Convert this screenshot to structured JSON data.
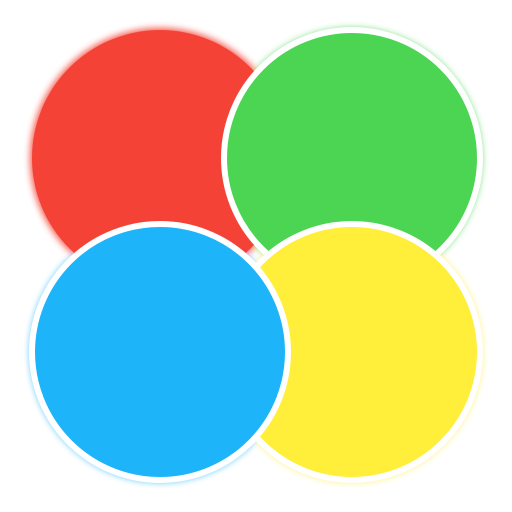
{
  "icon": {
    "name": "four-circle-logo",
    "colors": {
      "red": "#F44336",
      "green": "#4CD453",
      "blue": "#1EB4FA",
      "yellow": "#FFEE3A",
      "separator": "#ffffff"
    },
    "circles": [
      "red",
      "green",
      "blue",
      "yellow"
    ]
  }
}
